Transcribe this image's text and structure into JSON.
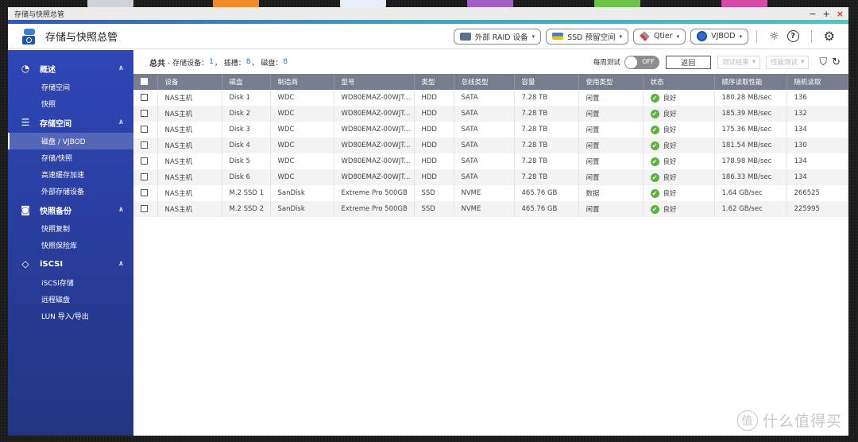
{
  "window": {
    "title": "存储与快照总管",
    "controls": {
      "minimize": "−",
      "maximize": "+",
      "close": "×"
    }
  },
  "appbar": {
    "title": "存储与快照总管",
    "buttons": [
      {
        "label": "外部 RAID 设备",
        "icon": "raid-device-icon"
      },
      {
        "label": "SSD 预留空间",
        "icon": "ssd-icon"
      },
      {
        "label": "Qtier",
        "icon": "qtier-icon"
      },
      {
        "label": "VJBOD",
        "icon": "vjbod-icon"
      }
    ],
    "caret": "▾",
    "icons": {
      "diagnostics": "☼",
      "help": "?",
      "settings": "⚙"
    }
  },
  "sidebar": {
    "groups": [
      {
        "label": "概述",
        "icon": "◔",
        "chevron": "∧",
        "items": [
          {
            "label": "存储空间"
          },
          {
            "label": "快照"
          }
        ]
      },
      {
        "label": "存储空间",
        "icon": "☰",
        "chevron": "∧",
        "items": [
          {
            "label": "磁盘 / VJBOD",
            "active": true
          },
          {
            "label": "存储/快照"
          },
          {
            "label": "高速缓存加速"
          },
          {
            "label": "外部存储设备"
          }
        ]
      },
      {
        "label": "快照备份",
        "icon": "◙",
        "chevron": "∧",
        "items": [
          {
            "label": "快照复制"
          },
          {
            "label": "快照保险库"
          }
        ]
      },
      {
        "label": "iSCSI",
        "icon": "◇",
        "chevron": "∧",
        "items": [
          {
            "label": "iSCSI存储"
          },
          {
            "label": "远程磁盘"
          },
          {
            "label": "LUN 导入/导出"
          }
        ]
      }
    ]
  },
  "summary": {
    "total_label": "总共",
    "devices_label": "- 存储设备：",
    "devices": "1",
    "slots_label": "， 插槽：",
    "slots": "8",
    "disks_label": "， 磁盘：",
    "disks": "8",
    "weekly_test_label": "每周测试",
    "toggle_state": "OFF",
    "back_label": "返回",
    "test_results_label": "测试结果",
    "perf_test_label": "性能测试",
    "caret": "▾",
    "filter_icon": "⛉",
    "refresh_icon": "↻"
  },
  "table": {
    "columns": [
      "设备",
      "磁盘",
      "制造商",
      "型号",
      "类型",
      "总线类型",
      "容量",
      "使用类型",
      "状态",
      "顺序读取性能",
      "随机读取"
    ],
    "rows": [
      {
        "device": "NAS主机",
        "disk": "Disk 1",
        "vendor": "WDC",
        "model": "WD80EMAZ-00WJT...",
        "type": "HDD",
        "bus": "SATA",
        "capacity": "7.28 TB",
        "usage": "闲置",
        "status": "良好",
        "seq_read": "180.28 MB/sec",
        "rand_read": "136"
      },
      {
        "device": "NAS主机",
        "disk": "Disk 2",
        "vendor": "WDC",
        "model": "WD80EMAZ-00WJT...",
        "type": "HDD",
        "bus": "SATA",
        "capacity": "7.28 TB",
        "usage": "闲置",
        "status": "良好",
        "seq_read": "185.39 MB/sec",
        "rand_read": "132"
      },
      {
        "device": "NAS主机",
        "disk": "Disk 3",
        "vendor": "WDC",
        "model": "WD80EMAZ-00WJT...",
        "type": "HDD",
        "bus": "SATA",
        "capacity": "7.28 TB",
        "usage": "闲置",
        "status": "良好",
        "seq_read": "175.36 MB/sec",
        "rand_read": "134"
      },
      {
        "device": "NAS主机",
        "disk": "Disk 4",
        "vendor": "WDC",
        "model": "WD80EMAZ-00WJT...",
        "type": "HDD",
        "bus": "SATA",
        "capacity": "7.28 TB",
        "usage": "闲置",
        "status": "良好",
        "seq_read": "181.54 MB/sec",
        "rand_read": "130"
      },
      {
        "device": "NAS主机",
        "disk": "Disk 5",
        "vendor": "WDC",
        "model": "WD80EMAZ-00WJT...",
        "type": "HDD",
        "bus": "SATA",
        "capacity": "7.28 TB",
        "usage": "闲置",
        "status": "良好",
        "seq_read": "178.98 MB/sec",
        "rand_read": "134"
      },
      {
        "device": "NAS主机",
        "disk": "Disk 6",
        "vendor": "WDC",
        "model": "WD80EMAZ-00WJT...",
        "type": "HDD",
        "bus": "SATA",
        "capacity": "7.28 TB",
        "usage": "闲置",
        "status": "良好",
        "seq_read": "186.33 MB/sec",
        "rand_read": "134"
      },
      {
        "device": "NAS主机",
        "disk": "M.2 SSD 1",
        "vendor": "SanDisk",
        "model": "Extreme Pro 500GB",
        "type": "SSD",
        "bus": "NVME",
        "capacity": "465.76 GB",
        "usage": "数据",
        "status": "良好",
        "seq_read": "1.64 GB/sec",
        "rand_read": "266525"
      },
      {
        "device": "NAS主机",
        "disk": "M.2 SSD 2",
        "vendor": "SanDisk",
        "model": "Extreme Pro 500GB",
        "type": "SSD",
        "bus": "NVME",
        "capacity": "465.76 GB",
        "usage": "闲置",
        "status": "良好",
        "seq_read": "1.62 GB/sec",
        "rand_read": "225995"
      }
    ],
    "status_icon": "✔"
  },
  "watermark": {
    "badge": "值",
    "text": "什么值得买"
  },
  "colors": {
    "sidebar": "#2e46b6",
    "header": "#777d8e",
    "ok": "#5cb23c",
    "accent": "#2fa6c8"
  }
}
